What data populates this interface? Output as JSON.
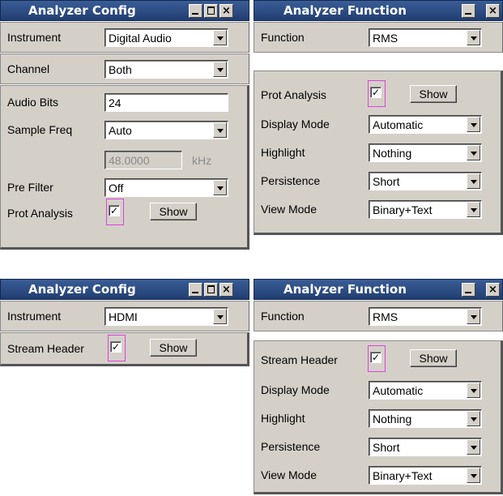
{
  "panels": {
    "config_digital": {
      "title": "Analyzer Config",
      "instrument": {
        "label": "Instrument",
        "value": "Digital Audio"
      },
      "channel": {
        "label": "Channel",
        "value": "Both"
      },
      "audio_bits": {
        "label": "Audio Bits",
        "value": "24"
      },
      "sample_freq": {
        "label": "Sample Freq",
        "value": "Auto"
      },
      "freq_value": {
        "value": "48.0000",
        "unit": "kHz"
      },
      "pre_filter": {
        "label": "Pre Filter",
        "value": "Off"
      },
      "prot_analysis": {
        "label": "Prot Analysis",
        "checked": true,
        "button": "Show"
      }
    },
    "function_digital": {
      "title": "Analyzer Function",
      "function": {
        "label": "Function",
        "value": "RMS"
      },
      "prot_analysis": {
        "label": "Prot Analysis",
        "checked": true,
        "button": "Show"
      },
      "display_mode": {
        "label": "Display Mode",
        "value": "Automatic"
      },
      "highlight": {
        "label": "Highlight",
        "value": "Nothing"
      },
      "persistence": {
        "label": "Persistence",
        "value": "Short"
      },
      "view_mode": {
        "label": "View Mode",
        "value": "Binary+Text"
      }
    },
    "config_hdmi": {
      "title": "Analyzer Config",
      "instrument": {
        "label": "Instrument",
        "value": "HDMI"
      },
      "stream_header": {
        "label": "Stream Header",
        "checked": true,
        "button": "Show"
      }
    },
    "function_hdmi": {
      "title": "Analyzer Function",
      "function": {
        "label": "Function",
        "value": "RMS"
      },
      "stream_header": {
        "label": "Stream Header",
        "checked": true,
        "button": "Show"
      },
      "display_mode": {
        "label": "Display Mode",
        "value": "Automatic"
      },
      "highlight": {
        "label": "Highlight",
        "value": "Nothing"
      },
      "persistence": {
        "label": "Persistence",
        "value": "Short"
      },
      "view_mode": {
        "label": "View Mode",
        "value": "Binary+Text"
      }
    }
  },
  "icons": {
    "minimize": "minimize-icon",
    "maximize": "maximize-icon",
    "close": "close-icon",
    "checkmark": "✓"
  },
  "colors": {
    "titlebar": "#2b4a80",
    "panel": "#d4d0c8",
    "highlight": "#e040e0"
  }
}
